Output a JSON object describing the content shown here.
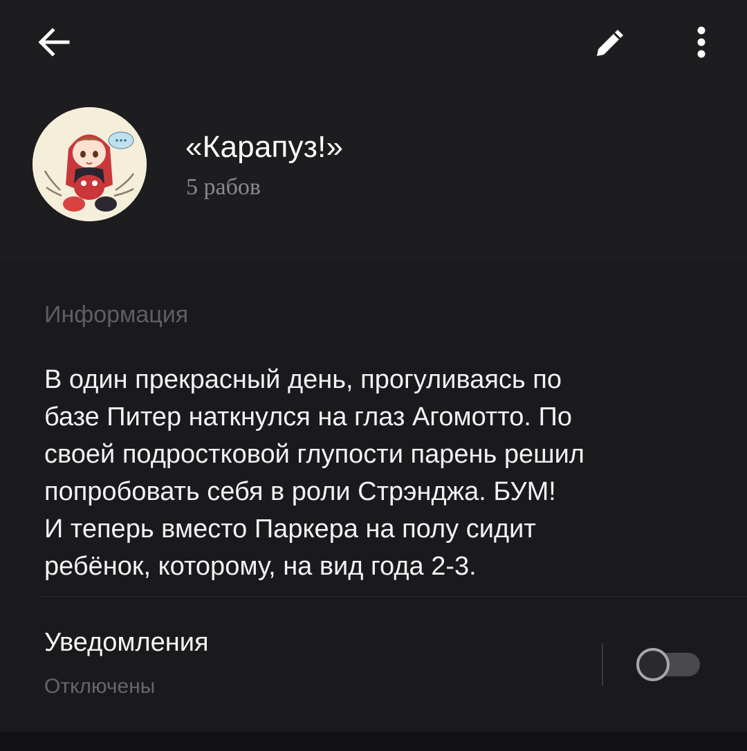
{
  "toolbar": {
    "back_icon": "arrow-left-icon",
    "edit_icon": "pencil-icon",
    "menu_icon": "more-vertical-icon"
  },
  "chat": {
    "title": "«Карапуз!»",
    "subtitle": "5 рабов",
    "avatar": "avatar-illustration"
  },
  "info": {
    "heading": "Информация",
    "lines": [
      "В один прекрасный день, прогуливаясь по",
      "базе Питер наткнулся на глаз Агомотто. По",
      "своей подростковой глупости парень решил",
      "попробовать себя в роли Стрэнджа. БУМ!",
      "И теперь вместо Паркера на полу сидит",
      "ребёнок, которому, на вид года 2-3."
    ]
  },
  "notifications": {
    "label": "Уведомления",
    "state": "Отключены",
    "toggle_on": false
  },
  "colors": {
    "background": "#1c1b1d",
    "text_primary": "#ffffff",
    "text_secondary": "#8a898c",
    "section_heading": "#5f5e61"
  }
}
